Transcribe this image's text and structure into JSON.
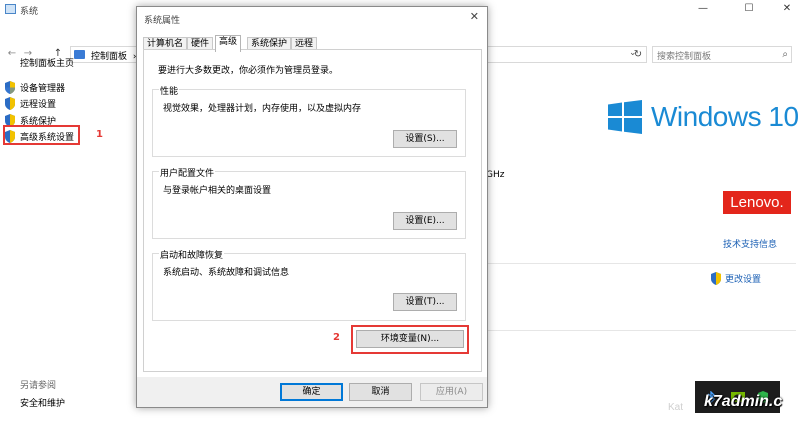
{
  "background_window": {
    "title": "系统",
    "controls": {
      "minimize": "—",
      "maximize": "☐",
      "close": "✕"
    },
    "nav": {
      "back": "←",
      "forward": "→",
      "up": "↑"
    },
    "breadcrumb": [
      "控制面板",
      "›"
    ],
    "address_dropdown": "⌄",
    "refresh": "↻",
    "search_placeholder": "搜索控制面板",
    "sidebar": {
      "home": "控制面板主页",
      "items": [
        {
          "label": "设备管理器"
        },
        {
          "label": "远程设置"
        },
        {
          "label": "系统保护"
        },
        {
          "label": "高级系统设置"
        }
      ],
      "see_also": "另请参阅",
      "security_maintenance": "安全和维护"
    },
    "annotation_1": "1",
    "annotation_2": "2",
    "windows_logo_text": "Windows 10",
    "ghz_text": "GHz",
    "lenovo_text": "Lenovo.",
    "support_link": "技术支持信息",
    "change_settings": "更改设置",
    "watermark": "k7admin.c",
    "watermark_left": "Kat"
  },
  "dialog": {
    "title": "系统属性",
    "close": "✕",
    "tabs": [
      "计算机名",
      "硬件",
      "高级",
      "系统保护",
      "远程"
    ],
    "active_tab": "高级",
    "admin_note": "要进行大多数更改，你必须作为管理员登录。",
    "groups": {
      "performance": {
        "label": "性能",
        "description": "视觉效果，处理器计划，内存使用，以及虚拟内存",
        "button": "设置(S)..."
      },
      "user_profiles": {
        "label": "用户配置文件",
        "description": "与登录帐户相关的桌面设置",
        "button": "设置(E)..."
      },
      "startup_recovery": {
        "label": "启动和故障恢复",
        "description": "系统启动、系统故障和调试信息",
        "button": "设置(T)..."
      }
    },
    "env_button": "环境变量(N)...",
    "footer": {
      "ok": "确定",
      "cancel": "取消",
      "apply": "应用(A)"
    }
  },
  "colors": {
    "highlight_red": "#e53935",
    "win_blue": "#1a8ad4",
    "lenovo_red": "#e3261b",
    "link_blue": "#1a5fb4"
  }
}
